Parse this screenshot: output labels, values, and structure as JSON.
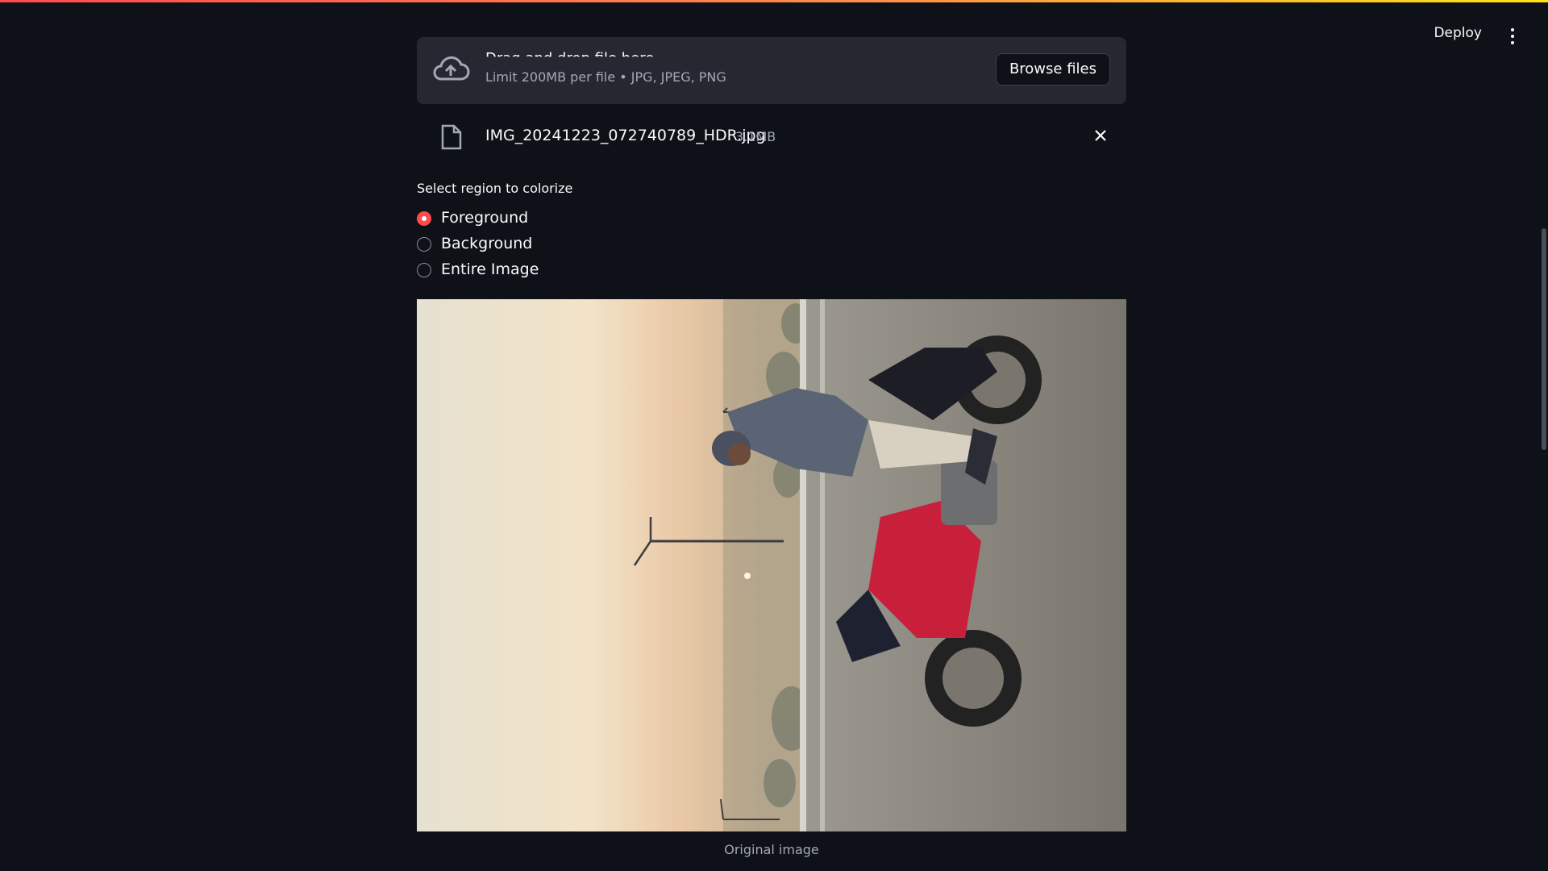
{
  "header": {
    "deploy_label": "Deploy",
    "menu_icon": "vertical-ellipsis-icon"
  },
  "uploader": {
    "title": "Drag and drop file here",
    "limit_text": "Limit 200MB per file • JPG, JPEG, PNG",
    "browse_label": "Browse files",
    "icon": "cloud-upload-icon"
  },
  "file": {
    "name": "IMG_20241223_072740789_HDR.jpg",
    "size": "3.1MB",
    "icon": "file-icon",
    "remove_icon": "close-icon"
  },
  "region": {
    "label": "Select region to colorize",
    "options": [
      {
        "label": "Foreground",
        "selected": true
      },
      {
        "label": "Background",
        "selected": false
      },
      {
        "label": "Entire Image",
        "selected": false
      }
    ]
  },
  "image": {
    "caption": "Original image"
  },
  "colors": {
    "background": "#0e1117",
    "surface": "#262730",
    "accent": "#ff4b4b",
    "muted_text": "#a3a8b8"
  }
}
